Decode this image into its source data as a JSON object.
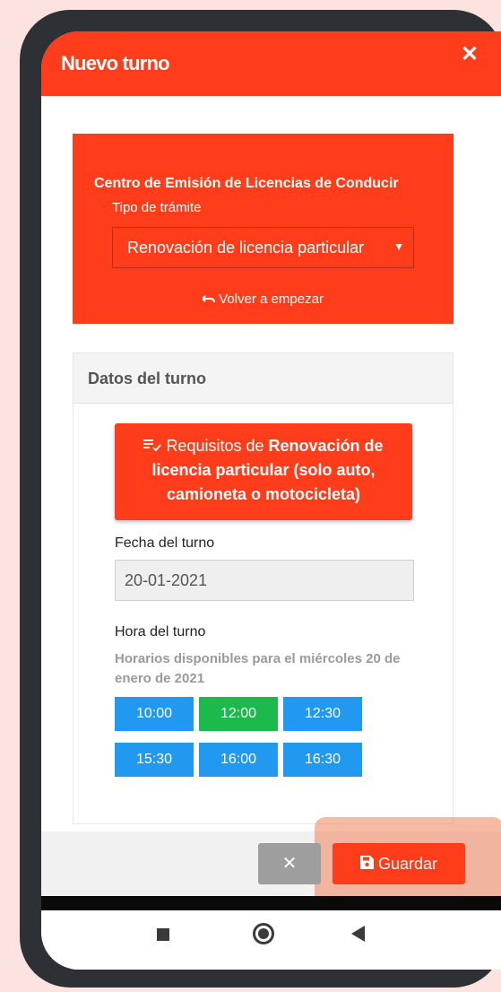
{
  "modal": {
    "title": "Nuevo turno",
    "close_glyph": "✕"
  },
  "form": {
    "center_title": "Centro de Emisión de Licencias de Conducir",
    "tipo_label": "Tipo de trámite",
    "tipo_value": "Renovación de licencia particular",
    "caret_glyph": "▼",
    "volver_icon": "undo-icon",
    "volver_text": "Volver a empezar"
  },
  "datos": {
    "title": "Datos del turno",
    "req_icon": "list-check-icon",
    "req_prefix": "Requisitos de",
    "req_bold": "Renovación de licencia particular (solo auto, camioneta o motocicleta)",
    "fecha_label": "Fecha del turno",
    "fecha_value": "20-01-2021",
    "hora_label": "Hora del turno",
    "horarios_note": "Horarios disponibles para el miércoles 20 de enero de 2021",
    "slots": [
      {
        "time": "10:00",
        "selected": false
      },
      {
        "time": "12:00",
        "selected": true
      },
      {
        "time": "12:30",
        "selected": false
      },
      {
        "time": "15:30",
        "selected": false
      },
      {
        "time": "16:00",
        "selected": false
      },
      {
        "time": "16:30",
        "selected": false
      }
    ]
  },
  "footer": {
    "cancel_glyph": "✕",
    "save_icon": "floppy-disk-icon",
    "save_label": "Guardar"
  },
  "colors": {
    "primary": "#ff3d1a",
    "slot": "#2299f0",
    "slot_selected": "#1cb94c",
    "background": "#fde3df"
  },
  "navbar": {
    "icons": [
      "recents-square-icon",
      "home-circle-icon",
      "back-triangle-icon"
    ]
  }
}
